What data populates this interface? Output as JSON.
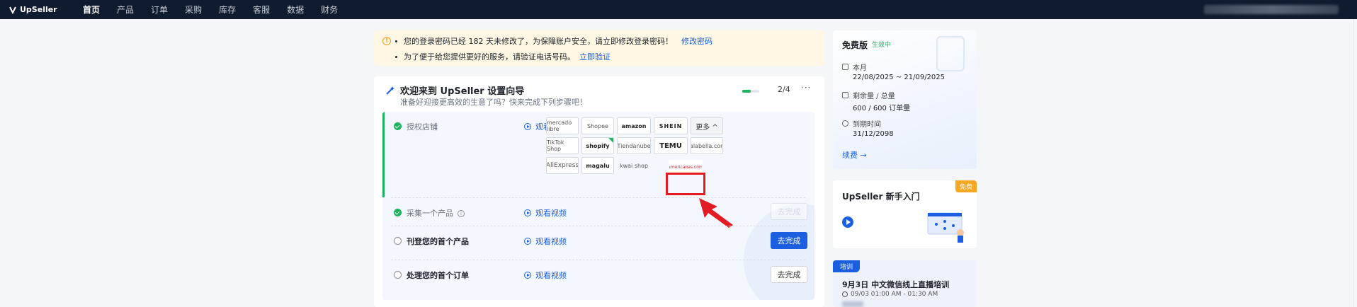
{
  "app": {
    "name": "UpSeller",
    "nav": [
      "首页",
      "产品",
      "订单",
      "采购",
      "库存",
      "客服",
      "数据",
      "财务"
    ],
    "active_nav": "首页"
  },
  "notice": {
    "line1": "您的登录密码已经 182 天未修改了，为保障账户安全，请立即修改登录密码！",
    "line1_link": "修改密码",
    "line2": "为了便于给您提供更好的服务，请验证电话号码。",
    "line2_link": "立即验证"
  },
  "wizard": {
    "title": "欢迎来到 UpSeller 设置向导",
    "subtitle": "准备好迎接更高效的生意了吗？快来完成下列步骤吧！",
    "progress_text": "2/4",
    "progress_fraction": 0.5,
    "video_label": "观看视频",
    "steps": [
      {
        "label": "授权店铺",
        "status": "done"
      },
      {
        "label": "采集一个产品",
        "status": "done"
      },
      {
        "label": "刊登您的首个产品",
        "status": "todo",
        "button": "去完成"
      },
      {
        "label": "处理您的首个订单",
        "status": "todo",
        "button": "去完成"
      }
    ],
    "step2_button": "去完成",
    "more_button": "更多 ^",
    "shops": [
      "mercado libre",
      "Shopee",
      "amazon",
      "SHEIN",
      "TikTok Shop",
      "shopify",
      "Tiendanube",
      "TEMU",
      "falabella.com",
      "AliExpress",
      "magalu",
      "kwai shop",
      "americanas.com"
    ]
  },
  "plan": {
    "title": "免费版",
    "badge": "生效中",
    "period_label": "本月",
    "period_value": "22/08/2025 ~ 21/09/2025",
    "quota_label": "剩余量 / 总量",
    "quota_value": "600 / 600 订单量",
    "expire_label": "到期时间",
    "expire_value": "31/12/2098",
    "renew": "续费 →"
  },
  "intro": {
    "tag": "免费",
    "title": "UpSeller 新手入门"
  },
  "training": {
    "tag": "培训",
    "title": "9月3日 中文微信线上直播培训",
    "time": "09/03 01:00 AM - 01:30 AM"
  },
  "colors": {
    "nav_bg": "#0f1b2e",
    "primary": "#1b5fe0",
    "success": "#1bb35b",
    "highlight": "#e31b23"
  }
}
